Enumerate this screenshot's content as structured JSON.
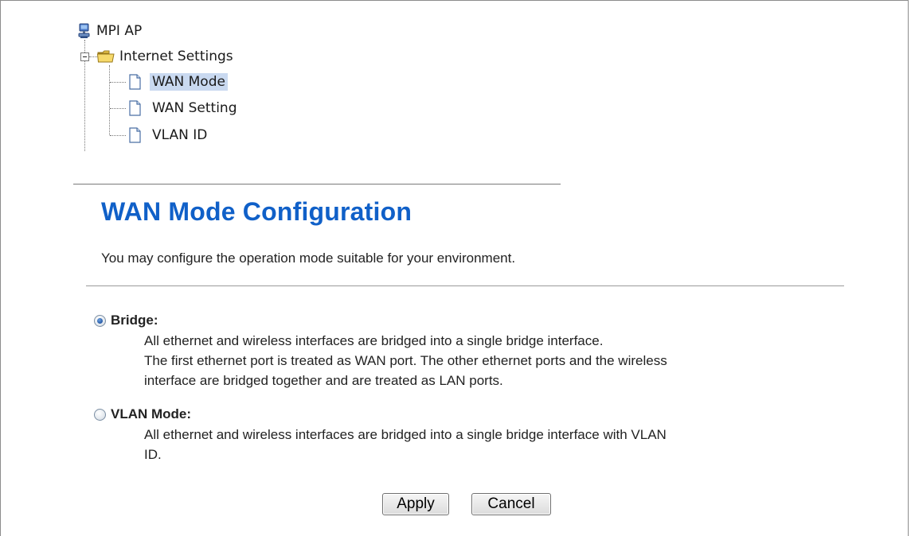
{
  "tree": {
    "root": {
      "label": "MPI AP",
      "icon": "network-computer-icon"
    },
    "folder": {
      "label": "Internet Settings",
      "icon": "folder-icon",
      "expanded": true
    },
    "items": [
      {
        "label": "WAN Mode",
        "icon": "page-icon",
        "selected": true
      },
      {
        "label": "WAN Setting",
        "icon": "page-icon",
        "selected": false
      },
      {
        "label": "VLAN ID",
        "icon": "page-icon",
        "selected": false
      }
    ]
  },
  "main": {
    "title": "WAN Mode Configuration",
    "description": "You may configure the operation mode suitable for your environment.",
    "options": [
      {
        "name": "Bridge:",
        "checked": true,
        "lines": [
          "All ethernet and wireless interfaces are bridged into a single bridge interface.",
          "The first ethernet port is treated as WAN port. The other ethernet ports and the wireless",
          "interface are bridged together and are treated as LAN ports."
        ]
      },
      {
        "name": "VLAN Mode:",
        "checked": false,
        "lines": [
          "All ethernet and wireless interfaces are bridged into a single bridge interface with VLAN",
          "ID."
        ]
      }
    ],
    "buttons": {
      "apply": "Apply",
      "cancel": "Cancel"
    }
  },
  "colors": {
    "title": "#1060c8",
    "selection": "#c9d9f0"
  }
}
